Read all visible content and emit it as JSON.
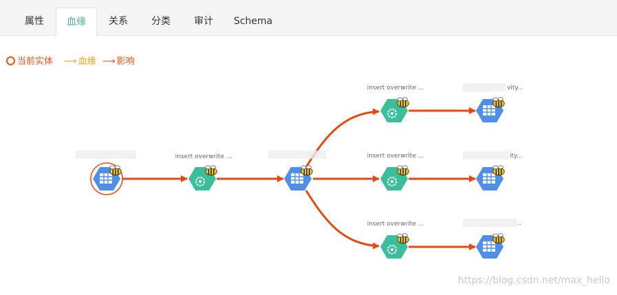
{
  "tabs": [
    {
      "label": "属性",
      "active": false
    },
    {
      "label": "血缘",
      "active": true
    },
    {
      "label": "关系",
      "active": false
    },
    {
      "label": "分类",
      "active": false
    },
    {
      "label": "审计",
      "active": false
    },
    {
      "label": "Schema",
      "active": false
    }
  ],
  "legend": {
    "current_entity": "当前实体",
    "lineage": "血缘",
    "impact": "影响",
    "current_color": "#e8531b",
    "lineage_color": "#e8a21b",
    "impact_color": "#e8531b"
  },
  "colors": {
    "edge": "#e8470e",
    "table_node": "#4f8fe6",
    "process_node": "#3bbf9b",
    "accent": "#4ab194"
  },
  "nodes": [
    {
      "id": "t1",
      "kind": "table",
      "label": "",
      "current": true
    },
    {
      "id": "p1",
      "kind": "process",
      "label": "insert overwrite ..."
    },
    {
      "id": "t2",
      "kind": "table",
      "label": ""
    },
    {
      "id": "p2",
      "kind": "process",
      "label": "insert overwrite ..."
    },
    {
      "id": "p3",
      "kind": "process",
      "label": "insert overwrite ..."
    },
    {
      "id": "p4",
      "kind": "process",
      "label": "insert overwrite ..."
    },
    {
      "id": "t3",
      "kind": "table",
      "label": "vity..."
    },
    {
      "id": "t4",
      "kind": "table",
      "label": "ity..."
    },
    {
      "id": "t5",
      "kind": "table",
      "label": ".."
    }
  ],
  "watermark": "https://blog.csdn.net/max_hello"
}
